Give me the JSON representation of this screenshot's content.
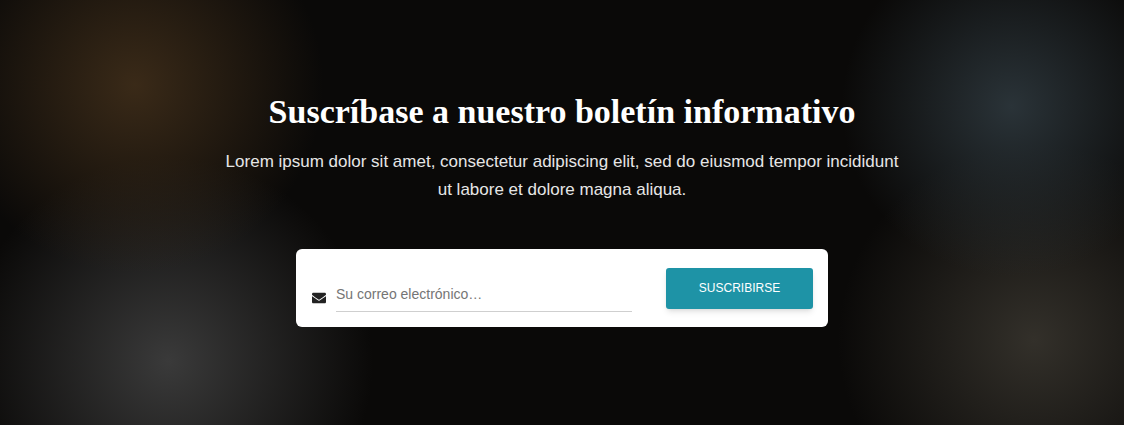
{
  "newsletter": {
    "heading": "Suscríbase a nuestro boletín informativo",
    "description": "Lorem ipsum dolor sit amet, consectetur adipiscing elit, sed do eiusmod tempor incididunt ut labore et dolore magna aliqua.",
    "form": {
      "placeholder": "Su correo electrónico…",
      "button": "SUSCRIBIRSE"
    }
  }
}
